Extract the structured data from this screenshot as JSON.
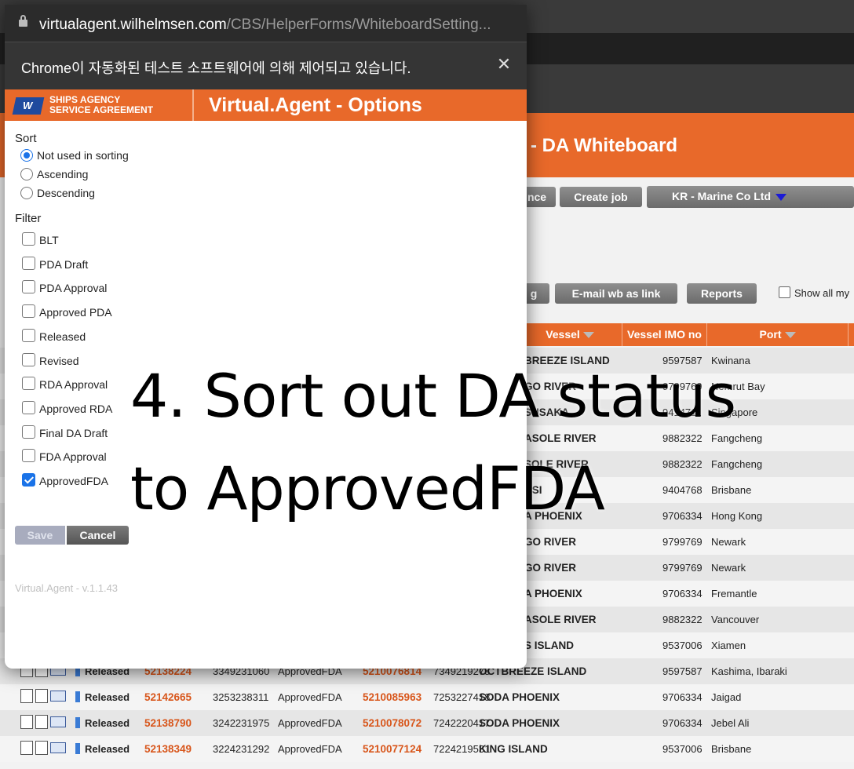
{
  "background_page": {
    "title": "- DA Whiteboard",
    "buttons": {
      "partial_left": "nce",
      "create_job": "Create job",
      "partial_left2": "g",
      "email_wb": "E-mail wb as link",
      "reports": "Reports"
    },
    "account": "KR - Marine Co Ltd",
    "show_all": "Show all my",
    "columns": {
      "vessel": "Vessel",
      "imo": "Vessel IMO no",
      "port": "Port"
    },
    "rows": [
      {
        "vessel": "BREEZE ISLAND",
        "imo": "9597587",
        "port": "Kwinana"
      },
      {
        "vessel": "GO RIVER",
        "imo": "9799769",
        "port": "Nemrut Bay"
      },
      {
        "vessel": "SUSAKA",
        "imo": "9414711",
        "port": "Singapore"
      },
      {
        "vessel": "ASOLE RIVER",
        "imo": "9882322",
        "port": "Fangcheng"
      },
      {
        "vessel": "SOLE RIVER",
        "imo": "9882322",
        "port": "Fangcheng"
      },
      {
        "vessel": "ASI",
        "imo": "9404768",
        "port": "Brisbane"
      },
      {
        "vessel": "A PHOENIX",
        "imo": "9706334",
        "port": "Hong Kong"
      },
      {
        "vessel": "GO RIVER",
        "imo": "9799769",
        "port": "Newark"
      },
      {
        "vessel": "GO RIVER",
        "imo": "9799769",
        "port": "Newark"
      },
      {
        "vessel": "A PHOENIX",
        "imo": "9706334",
        "port": "Fremantle"
      },
      {
        "vessel": "ASOLE RIVER",
        "imo": "9882322",
        "port": "Vancouver"
      },
      {
        "vessel": "S ISLAND",
        "imo": "9537006",
        "port": "Xiamen"
      }
    ],
    "full_rows": [
      {
        "status": "Released",
        "job": "52138224",
        "code1": "3349231060",
        "da": "ApprovedFDA",
        "pda": "5210076814",
        "code2": "7349219278",
        "vessel": "OCTBREEZE ISLAND",
        "imo": "9597587",
        "port": "Kashima, Ibaraki"
      },
      {
        "status": "Released",
        "job": "52142665",
        "code1": "3253238311",
        "da": "ApprovedFDA",
        "pda": "5210085963",
        "code2": "7253227418",
        "vessel": "SODA PHOENIX",
        "imo": "9706334",
        "port": "Jaigad"
      },
      {
        "status": "Released",
        "job": "52138790",
        "code1": "3242231975",
        "da": "ApprovedFDA",
        "pda": "5210078072",
        "code2": "7242220417",
        "vessel": "SODA PHOENIX",
        "imo": "9706334",
        "port": "Jebel Ali"
      },
      {
        "status": "Released",
        "job": "52138349",
        "code1": "3224231292",
        "da": "ApprovedFDA",
        "pda": "5210077124",
        "code2": "7224219531",
        "vessel": "KING ISLAND",
        "imo": "9537006",
        "port": "Brisbane"
      }
    ]
  },
  "popup": {
    "url_host": "virtualagent.wilhelmsen.com",
    "url_path": "/CBS/HelperForms/WhiteboardSetting...",
    "infobar_text": "Chrome이 자동화된 테스트 소프트웨어에 의해 제어되고 있습니다.",
    "brand_line1": "SHIPS AGENCY",
    "brand_line2": "SERVICE AGREEMENT",
    "brand_mark": "W",
    "title": "Virtual.Agent - Options",
    "sort_label": "Sort",
    "sort_options": [
      "Not used in sorting",
      "Ascending",
      "Descending"
    ],
    "sort_selected": "Not used in sorting",
    "filter_label": "Filter",
    "filters": [
      "BLT",
      "PDA Draft",
      "PDA Approval",
      "Approved PDA",
      "Released",
      "Revised",
      "RDA Approval",
      "Approved RDA",
      "Final DA Draft",
      "FDA Approval",
      "ApprovedFDA"
    ],
    "filter_checked": [
      "ApprovedFDA"
    ],
    "save": "Save",
    "cancel": "Cancel",
    "version": "Virtual.Agent - v.1.1.43"
  },
  "caption": {
    "line1": "4. Sort out DA status",
    "line2": "to ApprovedFDA"
  },
  "colors": {
    "accent": "#e8692a",
    "link": "#d8561b",
    "checkbox": "#1a73e8"
  }
}
